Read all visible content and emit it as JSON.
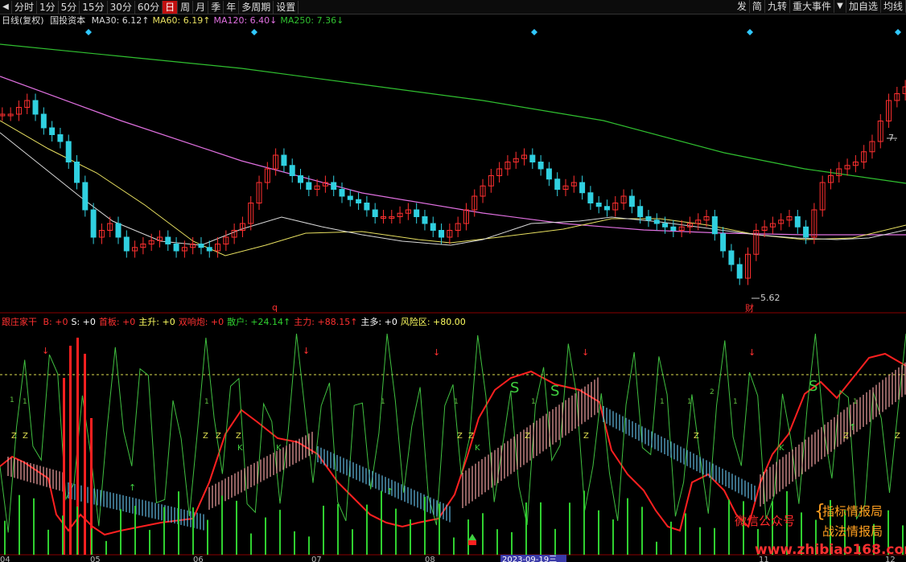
{
  "toolbar": {
    "left_icon": "◀",
    "tabs": [
      "分时",
      "1分",
      "5分",
      "15分",
      "30分",
      "60分",
      "日",
      "周",
      "月",
      "季",
      "年",
      "多周期",
      "设置"
    ],
    "active_tab": 6,
    "right_buttons": [
      "发",
      "简",
      "九转",
      "重大事件"
    ],
    "dropdown_icon": "▼",
    "add_watch": "加自选",
    "avg_line": "均线"
  },
  "ma_legend": {
    "period": "日线(复权)",
    "name": "国投资本",
    "items": [
      {
        "label": "MA30: 6.12",
        "arrow": "↑",
        "color": "#d8d8d8"
      },
      {
        "label": "MA60: 6.19",
        "arrow": "↑",
        "color": "#e8e060"
      },
      {
        "label": "MA120: 6.40",
        "arrow": "↓",
        "color": "#e070e0"
      },
      {
        "label": "MA250: 7.36",
        "arrow": "↓",
        "color": "#30c030"
      }
    ]
  },
  "indicator_legend": {
    "name": "跟庄家干",
    "items": [
      {
        "label": "B: +0",
        "color": "#ff3030"
      },
      {
        "label": "S: +0",
        "color": "#ffffff"
      },
      {
        "label": "首板: +0",
        "color": "#ff3030"
      },
      {
        "label": "主升: +0",
        "color": "#ffff60"
      },
      {
        "label": "双响炮: +0",
        "color": "#ff3030"
      },
      {
        "label": "散户: +24.14",
        "arrow": "↑",
        "color": "#30d030"
      },
      {
        "label": "主力: +88.15",
        "arrow": "↑",
        "color": "#ff3030"
      },
      {
        "label": "主多: +0",
        "color": "#ffffff"
      },
      {
        "label": "风险区: +80.00",
        "color": "#ffff60"
      }
    ]
  },
  "annotations": {
    "high_label": "7.",
    "low_label": "5.62",
    "cai_label": "财",
    "q_label": "q",
    "s_label": "S",
    "k_label": "K",
    "z_label": "Z",
    "one_label": "1",
    "two_label": "2"
  },
  "x_axis": {
    "labels": [
      "04",
      "05",
      "06",
      "07",
      "08",
      "2023-09-19三",
      "11",
      "12"
    ]
  },
  "watermark": {
    "left": "微信公众号",
    "right1": "指标情报局",
    "right2": "战法情报局",
    "url": "www.zhibiao168.com"
  },
  "chart_data": {
    "type": "candlestick",
    "series_colors": {
      "up": "#ff3030",
      "down": "#30d0e0",
      "ma30": "#d8d8d8",
      "ma60": "#e8e060",
      "ma120": "#e070e0",
      "ma250": "#30c030"
    },
    "y_range": [
      5.5,
      7.5
    ],
    "approx_close_path": [
      6.9,
      7.0,
      6.8,
      6.7,
      6.4,
      6.0,
      6.1,
      5.9,
      5.95,
      6.0,
      5.9,
      5.95,
      5.9,
      6.0,
      6.1,
      6.4,
      6.6,
      6.45,
      6.35,
      6.4,
      6.3,
      6.25,
      6.15,
      6.15,
      6.2,
      6.1,
      6.0,
      6.1,
      6.3,
      6.45,
      6.55,
      6.6,
      6.5,
      6.35,
      6.4,
      6.25,
      6.2,
      6.3,
      6.15,
      6.1,
      6.05,
      6.1,
      6.15,
      5.9,
      5.7,
      6.05,
      6.1,
      6.15,
      6.0,
      6.4,
      6.5,
      6.55,
      6.7,
      7.0,
      7.1
    ]
  }
}
